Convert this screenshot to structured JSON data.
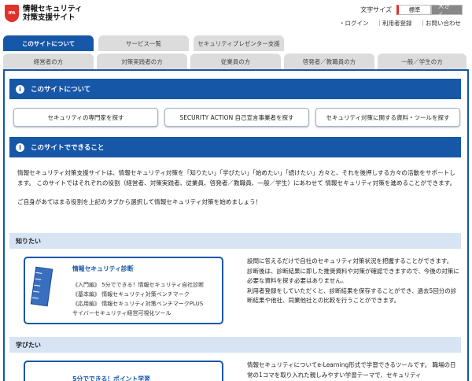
{
  "header": {
    "logo_badge": "IPA",
    "logo_line1": "情報セキュリティ",
    "logo_line2": "対策支援サイト",
    "font_size_label": "文字サイズ",
    "font_standard": "標準",
    "font_large": "大きく",
    "links": [
      "・ログイン",
      "｜利用者登録",
      "｜お問い合わせ"
    ]
  },
  "tabs_row1": [
    "このサイトについて",
    "サービス一覧",
    "セキュリティプレゼンター支援"
  ],
  "tabs_row2": [
    "経営者の方",
    "対策実践者の方",
    "従業員の方",
    "啓発者／教職員の方",
    "一般／学生の方"
  ],
  "section1": {
    "title": "このサイトについて",
    "buttons": [
      "セキュリティの専門家を探す",
      "SECURITY ACTION 自己宣言事業者を探す",
      "セキュリティ対策に関する資料・ツールを探す"
    ]
  },
  "section2": {
    "title": "このサイトでできること",
    "para1": "情報セキュリティ対策支援サイトは、情報セキュリティ対策を「知りたい」「学びたい」「始めたい」「続けたい」方々と、それを後押しする方々の活動をサポートします。 このサイトではそれぞれの役割（経営者、対策実践者、従業員、啓発者／教職員、一般／学生）にあわせて 情報セキュリティ対策を進めることができます。",
    "para2": "ご自身があてはまる役割を上記のタブから選択して情報セキュリティ対策を始めましょう！"
  },
  "know": {
    "band": "知りたい",
    "card_title": "情報セキュリティ診断",
    "card_items": [
      "《入門編》 5分でできる！情報セキュリティ自社診断",
      "《基本編》 情報セキュリティ対策ベンチマーク",
      "《応用編》 情報セキュリティ対策ベンチマークPLUS",
      "サイバーセキュリティ経営可視化ツール"
    ],
    "desc1": "設問に答えるだけで自社のセキュリティ対策状況を把握することができます。 診断後は、診断結果に即した推奨資料や対策が確認できますので、今後の対策に必要な資料を探す必要はありません。",
    "desc2": "利用者登録をしていただくと、診断結果を保存することができ、過去5回分の診断結果や他社、同業他社との比較を行うことができます。"
  },
  "learn": {
    "band": "学びたい",
    "card_title": "5分でできる！ポイント学習",
    "desc": "情報セキュリティについてe-Learning形式で学習できるツールです。 職場の日常の1コマを取り入れた親しみやすい学習テーマで、セキュリティ"
  }
}
